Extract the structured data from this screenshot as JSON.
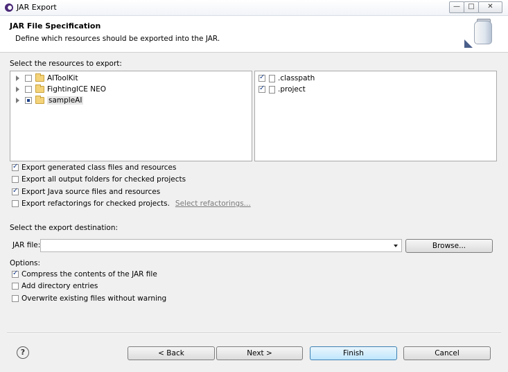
{
  "window": {
    "title": "JAR Export",
    "controls": {
      "minimize": "—",
      "maximize": "□",
      "close": "✕"
    }
  },
  "header": {
    "title": "JAR File Specification",
    "description": "Define which resources should be exported into the JAR."
  },
  "resources": {
    "label": "Select the resources to export:",
    "tree": [
      {
        "label": "AIToolKit",
        "state": "unchecked"
      },
      {
        "label": "FightingICE NEO",
        "state": "unchecked"
      },
      {
        "label": "sampleAI",
        "state": "partial"
      }
    ],
    "files": [
      {
        "label": ".classpath",
        "checked": true
      },
      {
        "label": ".project",
        "checked": true
      }
    ]
  },
  "export_options": [
    {
      "label": "Export generated class files and resources",
      "checked": true
    },
    {
      "label": "Export all output folders for checked projects",
      "checked": false
    },
    {
      "label": "Export Java source files and resources",
      "checked": true
    },
    {
      "label": "Export refactorings for checked projects.",
      "checked": false
    }
  ],
  "select_refactorings_link": "Select refactorings...",
  "destination": {
    "label": "Select the export destination:",
    "jar_file_label": "JAR file:",
    "jar_file_value": "",
    "browse_label": "Browse..."
  },
  "options": {
    "label": "Options:",
    "items": [
      {
        "label": "Compress the contents of the JAR file",
        "checked": true
      },
      {
        "label": "Add directory entries",
        "checked": false
      },
      {
        "label": "Overwrite existing files without warning",
        "checked": false
      }
    ]
  },
  "buttons": {
    "help": "?",
    "back": "< Back",
    "next": "Next >",
    "finish": "Finish",
    "cancel": "Cancel"
  }
}
